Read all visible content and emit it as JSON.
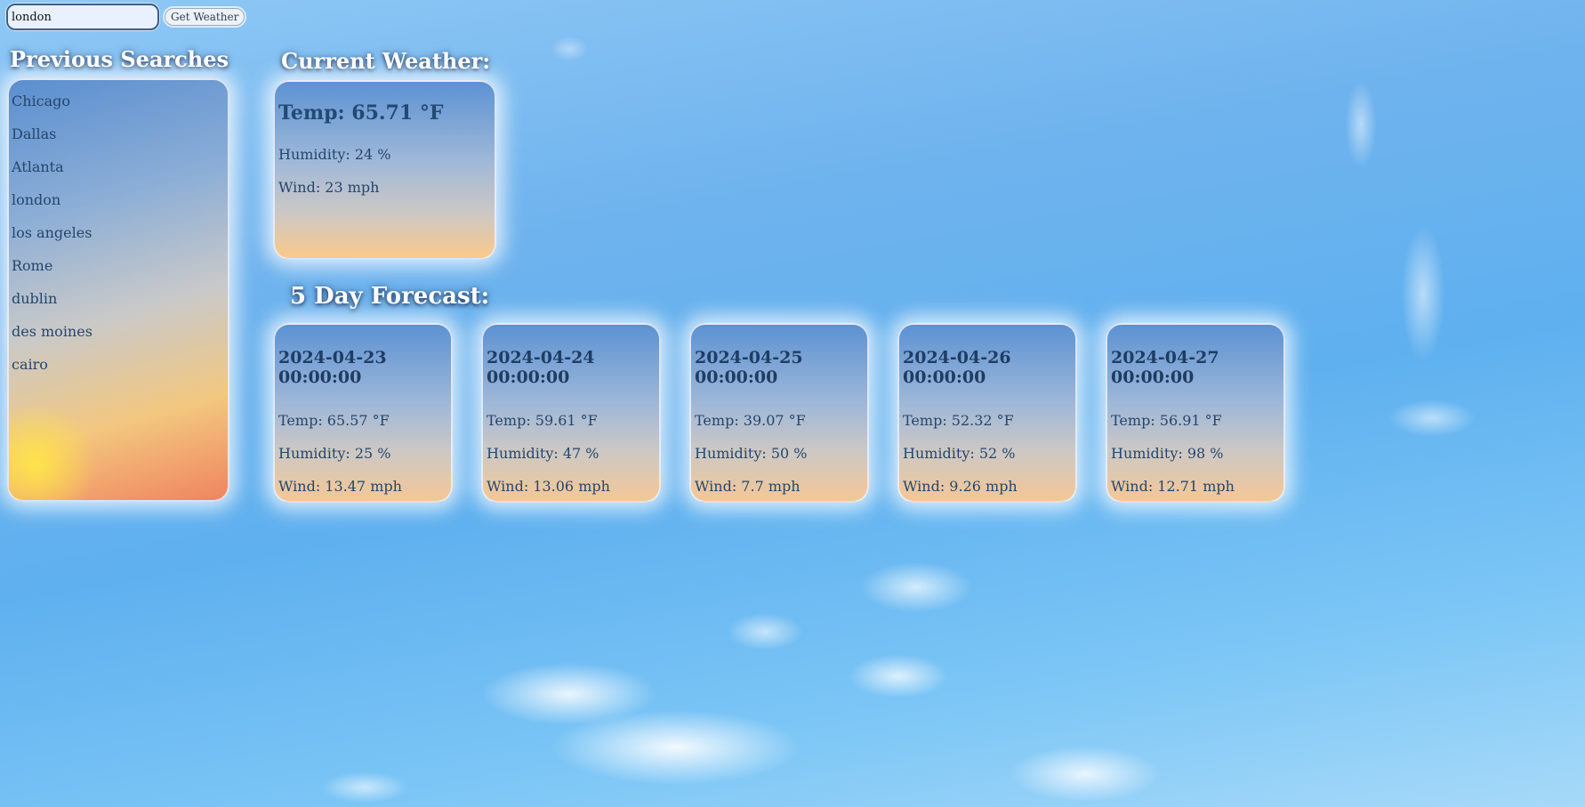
{
  "search": {
    "value": "london",
    "button_label": "Get Weather"
  },
  "history": {
    "title": "Previous Searches",
    "items": [
      "Chicago",
      "Dallas",
      "Atlanta",
      "london",
      "los angeles",
      "Rome",
      "dublin",
      "des moines",
      "cairo"
    ]
  },
  "current": {
    "title": "Current Weather:",
    "temp": "Temp: 65.71 °F",
    "humidity": "Humidity: 24 %",
    "wind": "Wind: 23 mph"
  },
  "forecast": {
    "title": "5 Day Forecast:",
    "days": [
      {
        "date": "2024-04-23 00:00:00",
        "temp": "Temp: 65.57 °F",
        "humidity": "Humidity: 25 %",
        "wind": "Wind: 13.47 mph"
      },
      {
        "date": "2024-04-24 00:00:00",
        "temp": "Temp: 59.61 °F",
        "humidity": "Humidity: 47 %",
        "wind": "Wind: 13.06 mph"
      },
      {
        "date": "2024-04-25 00:00:00",
        "temp": "Temp: 39.07 °F",
        "humidity": "Humidity: 50 %",
        "wind": "Wind: 7.7 mph"
      },
      {
        "date": "2024-04-26 00:00:00",
        "temp": "Temp: 52.32 °F",
        "humidity": "Humidity: 52 %",
        "wind": "Wind: 9.26 mph"
      },
      {
        "date": "2024-04-27 00:00:00",
        "temp": "Temp: 56.91 °F",
        "humidity": "Humidity: 98 %",
        "wind": "Wind: 12.71 mph"
      }
    ]
  }
}
